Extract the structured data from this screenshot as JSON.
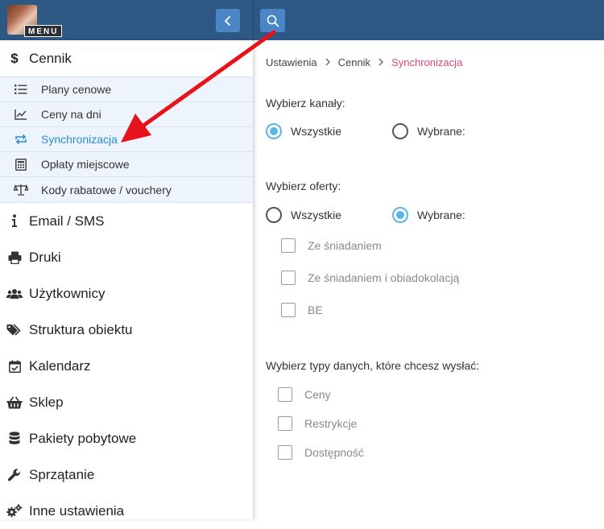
{
  "header": {
    "menu_label": "MENU"
  },
  "sidebar": {
    "group": {
      "label": "Cennik",
      "icon": "dollar-icon"
    },
    "subitems": [
      {
        "label": "Plany cenowe",
        "icon": "list-icon"
      },
      {
        "label": "Ceny na dni",
        "icon": "line-chart-icon"
      },
      {
        "label": "Synchronizacja",
        "icon": "sync-icon",
        "active": true
      },
      {
        "label": "Opłaty miejscowe",
        "icon": "calculator-icon"
      },
      {
        "label": "Kody rabatowe / vouchery",
        "icon": "balance-scale-icon"
      }
    ],
    "items": [
      {
        "label": "Email / SMS",
        "icon": "info-icon"
      },
      {
        "label": "Druki",
        "icon": "printer-icon"
      },
      {
        "label": "Użytkownicy",
        "icon": "users-icon"
      },
      {
        "label": "Struktura obiektu",
        "icon": "tags-icon"
      },
      {
        "label": "Kalendarz",
        "icon": "calendar-check-icon"
      },
      {
        "label": "Sklep",
        "icon": "basket-icon"
      },
      {
        "label": "Pakiety pobytowe",
        "icon": "database-icon"
      },
      {
        "label": "Sprzątanie",
        "icon": "wrench-icon"
      },
      {
        "label": "Inne ustawienia",
        "icon": "gears-icon"
      }
    ]
  },
  "breadcrumb": [
    "Ustawienia",
    "Cennik",
    "Synchronizacja"
  ],
  "channels": {
    "label": "Wybierz kanały:",
    "options": [
      {
        "label": "Wszystkie",
        "checked": true
      },
      {
        "label": "Wybrane:",
        "checked": false
      }
    ]
  },
  "offers": {
    "label": "Wybierz oferty:",
    "options": [
      {
        "label": "Wszystkie",
        "checked": false
      },
      {
        "label": "Wybrane:",
        "checked": true
      }
    ],
    "list": [
      "Ze śniadaniem",
      "Ze śniadaniem i obiadokolacją",
      "BE"
    ]
  },
  "data_types": {
    "label": "Wybierz typy danych, które chcesz wysłać:",
    "list": [
      "Ceny",
      "Restrykcje",
      "Dostępność"
    ]
  },
  "colors": {
    "header_bg": "#2e5884",
    "button_bg": "#4a86c5",
    "active_link": "#2a8cd8",
    "breadcrumb_current": "#e0457b",
    "radio_checked": "#5ab4e6",
    "annotation_arrow": "#e8121b"
  }
}
